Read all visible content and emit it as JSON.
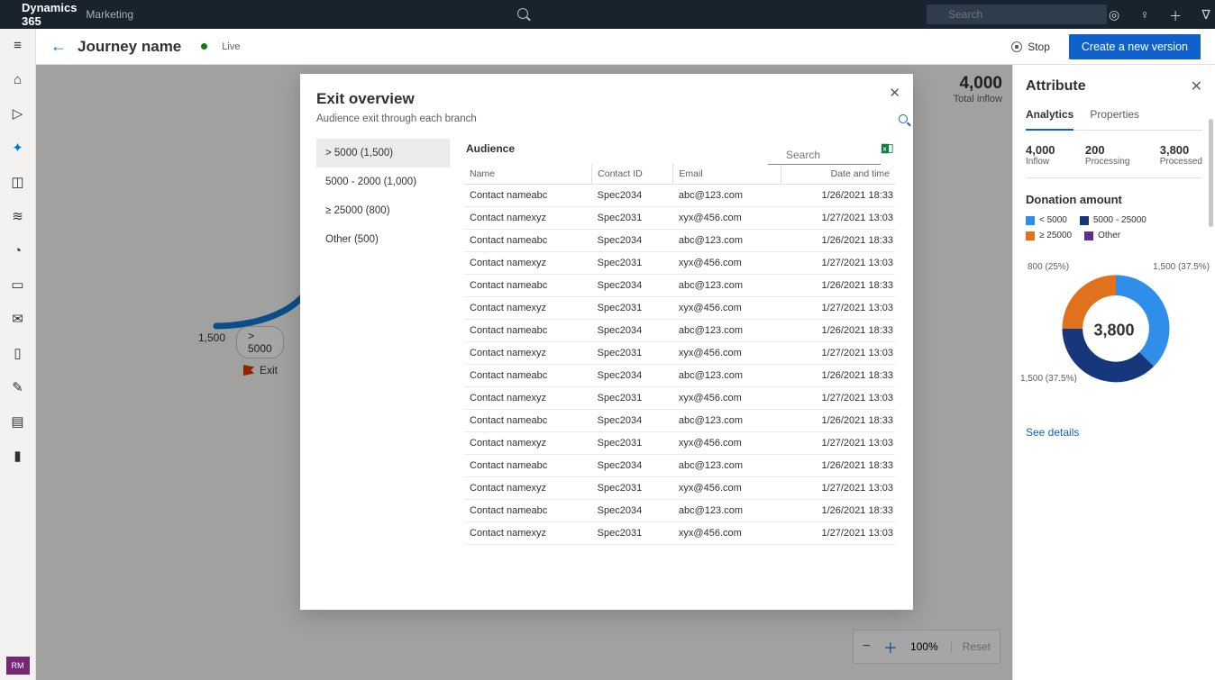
{
  "topbar": {
    "brand": "Dynamics 365",
    "sub": "Marketing",
    "search_placeholder": "Search"
  },
  "cmdbar": {
    "back": "←",
    "title": "Journey name",
    "status": "Live",
    "stop_label": "Stop",
    "new_version_label": "Create a new version"
  },
  "inflow": {
    "value": "4,000",
    "label": "Total inflow"
  },
  "node": {
    "count": "1,500",
    "pill": "> 5000",
    "exit_label": "Exit"
  },
  "zoom": {
    "level": "100%",
    "reset": "Reset"
  },
  "rightpanel": {
    "title": "Attribute",
    "tabs": {
      "analytics": "Analytics",
      "properties": "Properties"
    },
    "stats": [
      {
        "n": "4,000",
        "l": "Inflow"
      },
      {
        "n": "200",
        "l": "Processing"
      },
      {
        "n": "3,800",
        "l": "Processed"
      }
    ],
    "section_title": "Donation amount",
    "legend": [
      {
        "label": "< 5000",
        "color": "#2f8ee9"
      },
      {
        "label": "5000 - 25000",
        "color": "#17377d"
      },
      {
        "label": "≥ 25000",
        "color": "#e2711d"
      },
      {
        "label": "Other",
        "color": "#5b2e91"
      }
    ],
    "donut_center": "3,800",
    "donut_labels": {
      "tl": "800 (25%)",
      "tr": "1,500 (37.5%)",
      "bl": "1,500 (37.5%)"
    },
    "see_details": "See details"
  },
  "modal": {
    "title": "Exit overview",
    "subtitle": "Audience exit through each branch",
    "search_placeholder": "Search",
    "branches": [
      "> 5000 (1,500)",
      "5000 - 2000 (1,000)",
      "≥ 25000 (800)",
      "Other (500)"
    ],
    "audience_label": "Audience",
    "columns": {
      "name": "Name",
      "id": "Contact ID",
      "email": "Email",
      "dt": "Date and time"
    },
    "rows": [
      {
        "name": "Contact nameabc",
        "id": "Spec2034",
        "email": "abc@123.com",
        "dt": "1/26/2021 18:33"
      },
      {
        "name": "Contact namexyz",
        "id": "Spec2031",
        "email": "xyx@456.com",
        "dt": "1/27/2021 13:03"
      },
      {
        "name": "Contact nameabc",
        "id": "Spec2034",
        "email": "abc@123.com",
        "dt": "1/26/2021 18:33"
      },
      {
        "name": "Contact namexyz",
        "id": "Spec2031",
        "email": "xyx@456.com",
        "dt": "1/27/2021 13:03"
      },
      {
        "name": "Contact nameabc",
        "id": "Spec2034",
        "email": "abc@123.com",
        "dt": "1/26/2021 18:33"
      },
      {
        "name": "Contact namexyz",
        "id": "Spec2031",
        "email": "xyx@456.com",
        "dt": "1/27/2021 13:03"
      },
      {
        "name": "Contact nameabc",
        "id": "Spec2034",
        "email": "abc@123.com",
        "dt": "1/26/2021 18:33"
      },
      {
        "name": "Contact namexyz",
        "id": "Spec2031",
        "email": "xyx@456.com",
        "dt": "1/27/2021 13:03"
      },
      {
        "name": "Contact nameabc",
        "id": "Spec2034",
        "email": "abc@123.com",
        "dt": "1/26/2021 18:33"
      },
      {
        "name": "Contact namexyz",
        "id": "Spec2031",
        "email": "xyx@456.com",
        "dt": "1/27/2021 13:03"
      },
      {
        "name": "Contact nameabc",
        "id": "Spec2034",
        "email": "abc@123.com",
        "dt": "1/26/2021 18:33"
      },
      {
        "name": "Contact namexyz",
        "id": "Spec2031",
        "email": "xyx@456.com",
        "dt": "1/27/2021 13:03"
      },
      {
        "name": "Contact nameabc",
        "id": "Spec2034",
        "email": "abc@123.com",
        "dt": "1/26/2021 18:33"
      },
      {
        "name": "Contact namexyz",
        "id": "Spec2031",
        "email": "xyx@456.com",
        "dt": "1/27/2021 13:03"
      },
      {
        "name": "Contact nameabc",
        "id": "Spec2034",
        "email": "abc@123.com",
        "dt": "1/26/2021 18:33"
      },
      {
        "name": "Contact namexyz",
        "id": "Spec2031",
        "email": "xyx@456.com",
        "dt": "1/27/2021 13:03"
      }
    ]
  },
  "chart_data": {
    "type": "pie",
    "title": "Donation amount",
    "series": [
      {
        "name": "≥ 25000",
        "value": 800,
        "pct": 25.0,
        "color": "#e2711d"
      },
      {
        "name": "< 5000",
        "value": 1500,
        "pct": 37.5,
        "color": "#2f8ee9"
      },
      {
        "name": "5000 - 25000",
        "value": 1500,
        "pct": 37.5,
        "color": "#17377d"
      },
      {
        "name": "Other",
        "value": 0,
        "pct": 0.0,
        "color": "#5b2e91"
      }
    ],
    "total": 3800,
    "center_label": "3,800"
  }
}
